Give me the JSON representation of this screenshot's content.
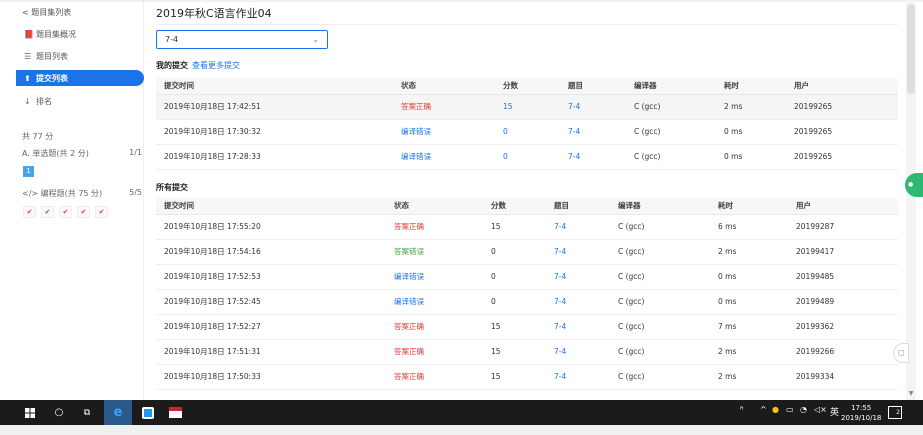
{
  "sidebar": {
    "back_label": "< 题目集列表",
    "items": [
      {
        "icon": "📕",
        "label": "题目集概况"
      },
      {
        "icon": "☰",
        "label": "题目列表"
      },
      {
        "icon": "⬆",
        "label": "提交列表"
      },
      {
        "icon": "↓",
        "label": "排名"
      }
    ],
    "total": "共 77 分",
    "sections": [
      {
        "icon": "A.",
        "label": "单选题(共 2 分)",
        "progress": "1/1"
      },
      {
        "icon": "</>",
        "label": "编程题(共 75 分)",
        "progress": "5/5"
      }
    ],
    "choice_number": "1",
    "checks": [
      "✔",
      "✔",
      "✔",
      "✔",
      "✔"
    ]
  },
  "main": {
    "title": "2019年秋C语言作业04",
    "select_value": "7-4",
    "my_submissions_label": "我的提交",
    "view_more_label": "查看更多提交",
    "all_submissions_label": "所有提交",
    "columns": [
      "提交时间",
      "状态",
      "分数",
      "题目",
      "编译器",
      "耗时",
      "用户"
    ],
    "my_rows": [
      {
        "time": "2019年10月18日 17:42:51",
        "status": "答案正确",
        "score": "15",
        "problem": "7-4",
        "compiler": "C (gcc)",
        "duration": "2 ms",
        "user": "20199265"
      },
      {
        "time": "2019年10月18日 17:30:32",
        "status": "编译错误",
        "score": "0",
        "problem": "7-4",
        "compiler": "C (gcc)",
        "duration": "0 ms",
        "user": "20199265"
      },
      {
        "time": "2019年10月18日 17:28:33",
        "status": "编译错误",
        "score": "0",
        "problem": "7-4",
        "compiler": "C (gcc)",
        "duration": "0 ms",
        "user": "20199265"
      }
    ],
    "all_rows": [
      {
        "time": "2019年10月18日 17:55:20",
        "status": "答案正确",
        "score": "15",
        "problem": "7-4",
        "compiler": "C (gcc)",
        "duration": "6 ms",
        "user": "20199287"
      },
      {
        "time": "2019年10月18日 17:54:16",
        "status": "答案错误",
        "score": "0",
        "problem": "7-4",
        "compiler": "C (gcc)",
        "duration": "2 ms",
        "user": "20199417"
      },
      {
        "time": "2019年10月18日 17:52:53",
        "status": "编译错误",
        "score": "0",
        "problem": "7-4",
        "compiler": "C (gcc)",
        "duration": "0 ms",
        "user": "20199485"
      },
      {
        "time": "2019年10月18日 17:52:45",
        "status": "编译错误",
        "score": "0",
        "problem": "7-4",
        "compiler": "C (gcc)",
        "duration": "0 ms",
        "user": "20199489"
      },
      {
        "time": "2019年10月18日 17:52:27",
        "status": "答案正确",
        "score": "15",
        "problem": "7-4",
        "compiler": "C (gcc)",
        "duration": "7 ms",
        "user": "20199362"
      },
      {
        "time": "2019年10月18日 17:51:31",
        "status": "答案正确",
        "score": "15",
        "problem": "7-4",
        "compiler": "C (gcc)",
        "duration": "2 ms",
        "user": "20199266"
      },
      {
        "time": "2019年10月18日 17:50:33",
        "status": "答案正确",
        "score": "15",
        "problem": "7-4",
        "compiler": "C (gcc)",
        "duration": "2 ms",
        "user": "20199334"
      }
    ],
    "status_colors": {
      "答案正确": "#e53935",
      "编译错误": "#1a73e8",
      "答案错误": "#43a047"
    }
  },
  "taskbar": {
    "ime_label": "英",
    "time": "17:55",
    "date": "2019/10/18",
    "notify_count": "2"
  }
}
